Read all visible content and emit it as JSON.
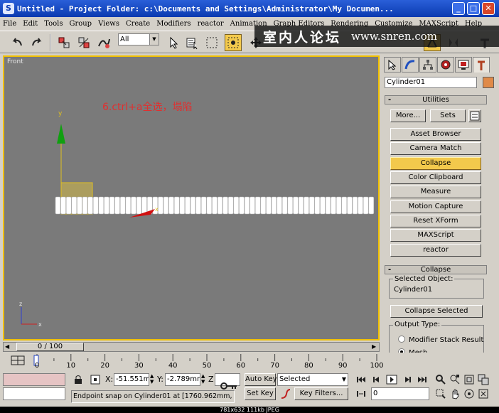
{
  "window": {
    "title": "Untitled - Project Folder: c:\\Documents and Settings\\Administrator\\My Documen...",
    "minimize": "_",
    "maximize": "□",
    "close": "✕"
  },
  "menu": [
    "File",
    "Edit",
    "Tools",
    "Group",
    "Views",
    "Create",
    "Modifiers",
    "reactor",
    "Animation",
    "Graph Editors",
    "Rendering",
    "Customize",
    "MAXScript",
    "Help"
  ],
  "watermark": {
    "cn": "室内人论坛",
    "url": "www.snren.com"
  },
  "toolbar": {
    "selection_filter": "All"
  },
  "viewport": {
    "label": "Front",
    "annotation": "6.ctrl+a全选，塌陷",
    "axis_y": "y",
    "axis_x": "x",
    "triad_z": "z",
    "triad_x": "x"
  },
  "command_panel": {
    "object_name": "Cylinder01",
    "object_color": "#e08a48",
    "utilities_title": "Utilities",
    "more_label": "More...",
    "sets_label": "Sets",
    "utility_buttons": [
      {
        "label": "Asset Browser",
        "active": false
      },
      {
        "label": "Camera Match",
        "active": false
      },
      {
        "label": "Collapse",
        "active": true
      },
      {
        "label": "Color Clipboard",
        "active": false
      },
      {
        "label": "Measure",
        "active": false
      },
      {
        "label": "Motion Capture",
        "active": false
      },
      {
        "label": "Reset XForm",
        "active": false
      },
      {
        "label": "MAXScript",
        "active": false
      },
      {
        "label": "reactor",
        "active": false
      }
    ],
    "collapse_title": "Collapse",
    "selected_object_label": "Selected Object:",
    "selected_object_value": "Cylinder01",
    "collapse_selected_label": "Collapse Selected",
    "output_type_label": "Output Type:",
    "output_options": [
      {
        "label": "Modifier Stack Result",
        "selected": false
      },
      {
        "label": "Mesh",
        "selected": true
      }
    ]
  },
  "timeline": {
    "frame_display": "0 / 100",
    "ticks": [
      "0",
      "10",
      "20",
      "30",
      "40",
      "50",
      "60",
      "70",
      "80",
      "90",
      "100"
    ]
  },
  "status": {
    "x_label": "X:",
    "x_value": "-51.551mm",
    "y_label": "Y:",
    "y_value": "-2.789mm",
    "z_label": "Z",
    "auto_key": "Auto Key",
    "set_key": "Set Key",
    "key_mode": "Selected",
    "key_filters": "Key Filters...",
    "frame_value": "0",
    "prompt": "Endpoint snap on Cylinder01 at [1760.962mm,"
  },
  "caption": "781x632  111kb  JPEG"
}
